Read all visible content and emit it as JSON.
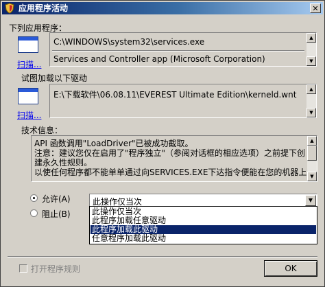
{
  "window": {
    "title": "应用程序活动"
  },
  "sections": {
    "app_label": "下列应用程序：",
    "driver_label": "试图加载以下驱动",
    "tech_label": "技术信息："
  },
  "app": {
    "path": "C:\\WINDOWS\\system32\\services.exe",
    "description": "Services and Controller app (Microsoft Corporation)",
    "scan_link": "扫描..."
  },
  "driver": {
    "path": "E:\\下载软件\\06.08.11\\EVEREST Ultimate Edition\\kerneld.wnt",
    "scan_link": "扫描..."
  },
  "tech_info": {
    "lines": [
      "API 函数调用\"LoadDriver\"已被成功截取。",
      "注意：建议您仅在启用了\"程序独立\"（参阅对话框的相应选项）之前提下创",
      "建永久性规则。",
      "以使任何程序都不能单单通过向SERVICES.EXE下达指令便能在您的机器上"
    ]
  },
  "actions": {
    "allow_label": "允许(A)",
    "block_label": "阻止(B)",
    "selected_option": "此操作仅当次",
    "options": [
      "此操作仅当次",
      "此程序加载任意驱动",
      "此程序加载此驱动",
      "任意程序加载此驱动"
    ],
    "highlighted_index": 2
  },
  "footer": {
    "rule_checkbox_label": "打开程序规则",
    "ok_label": "OK"
  }
}
